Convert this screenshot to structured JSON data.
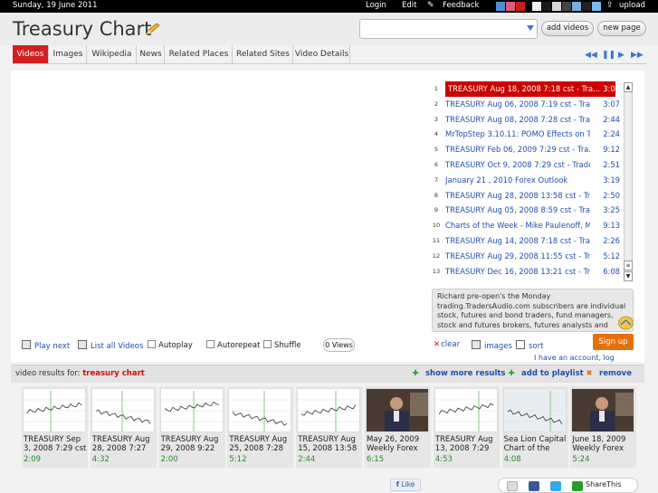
{
  "topbar": {
    "date": "Sunday, 19 June 2011",
    "links": [
      "Login",
      "Edit",
      "Feedback",
      "upload"
    ],
    "swatches": [
      "#4d8fd6",
      "#e05a7a",
      "#cc1c1c",
      "#eeeeee",
      "#1a1a1a",
      "#d8d8d8",
      "#444444",
      "#7aaee8",
      "#222222",
      "#77bbee"
    ]
  },
  "header": {
    "title": "Treasury Chart",
    "search_value": "",
    "add_videos": "add videos",
    "new_page": "new page"
  },
  "tabs": [
    "Videos",
    "Images",
    "Wikipedia",
    "News",
    "Related Places",
    "Related Sites",
    "Video Details"
  ],
  "nav_icons": [
    "rewind-icon",
    "pause-icon",
    "play-icon",
    "fast-forward-icon"
  ],
  "playlist": [
    {
      "n": "1",
      "title": "TREASURY Aug 18, 2008 7:18 cst - Tra...",
      "dur": "3:05",
      "selected": true
    },
    {
      "n": "2",
      "title": "TREASURY Aug 06, 2008 7:19 cst - Tra...",
      "dur": "3:07"
    },
    {
      "n": "3",
      "title": "TREASURY Aug 08, 2008 7:28 cst - Tra...",
      "dur": "2:44"
    },
    {
      "n": "4",
      "title": "MrTopStep 3.10.11: POMO Effects on Tr...",
      "dur": "2:24"
    },
    {
      "n": "5",
      "title": "TREASURY Feb 06, 2009 7:29 cst - Tra...",
      "dur": "9:12"
    },
    {
      "n": "6",
      "title": "TREASURY Oct 9, 2008 7:29 cst - Trade...",
      "dur": "2:51"
    },
    {
      "n": "7",
      "title": "January 21 , 2010 Forex Outlook",
      "dur": "3:19"
    },
    {
      "n": "8",
      "title": "TREASURY Aug 28, 2008 13:58 cst - Tr...",
      "dur": "2:50"
    },
    {
      "n": "9",
      "title": "TREASURY Aug 05, 2008 8:59 cst - Tra...",
      "dur": "3:25"
    },
    {
      "n": "10",
      "title": "Charts of the Week - Mike Paulenoff, MF...",
      "dur": "9:13"
    },
    {
      "n": "11",
      "title": "TREASURY Aug 14, 2008 7:18 cst - Tra...",
      "dur": "2:26"
    },
    {
      "n": "12",
      "title": "TREASURY Aug 29, 2008 11:55 cst - Tr...",
      "dur": "5:12"
    },
    {
      "n": "13",
      "title": "TREASURY Dec 16, 2008 13:21 cst - Tr...",
      "dur": "6:08"
    }
  ],
  "description": "Richard pre-open's the Monday trading.TradersAudio.com subscribers are individual stock, futures and bond traders, fund managers, stock and futures brokers, futures analysts and corporate institutions in countries around the world. TRLS",
  "controls": {
    "play_next": "Play next",
    "list_all": "List all Videos",
    "autoplay": "Autoplay",
    "autorepeat": "Autorepeat",
    "shuffle": "Shuffle",
    "views": "0 Views",
    "clear": "clear",
    "images": "images",
    "sort": "sort",
    "signup": "Sign up",
    "have_account": "I have an account, log"
  },
  "results": {
    "label": "video results for:",
    "query": "treasury chart",
    "show_more": "show more results",
    "add_playlist": "add to playlist",
    "remove": "remove"
  },
  "thumbs": [
    {
      "cap": "TREASURY Sep 3, 2008 7:29 cst -",
      "dur": "2:09",
      "kind": "chart"
    },
    {
      "cap": "TREASURY Aug 28, 2008 7:27 cst",
      "dur": "4:32",
      "kind": "chart"
    },
    {
      "cap": "TREASURY Aug 29, 2008 9:22 cst",
      "dur": "2:00",
      "kind": "chart"
    },
    {
      "cap": "TREASURY Aug 25, 2008 7:28 cst",
      "dur": "5:12",
      "kind": "chart"
    },
    {
      "cap": "TREASURY Aug 15, 2008 13:58",
      "dur": "2:44",
      "kind": "chart"
    },
    {
      "cap": "May 26, 2009 Weekly Forex",
      "dur": "6:15",
      "kind": "photo"
    },
    {
      "cap": "TREASURY Aug 13, 2008 7:29 cst",
      "dur": "4:53",
      "kind": "chart"
    },
    {
      "cap": "Sea Lion Capital Chart of the Day",
      "dur": "4:08",
      "kind": "dark"
    },
    {
      "cap": "June 18, 2009 Weekly Forex",
      "dur": "5:24",
      "kind": "photo"
    }
  ],
  "footer": {
    "like": "Like",
    "share": "ShareThis"
  },
  "colors": {
    "accent_red": "#d21f1f",
    "link_blue": "#2050a8",
    "signup_orange": "#e4700c",
    "duration_green": "#2a8a2a"
  }
}
